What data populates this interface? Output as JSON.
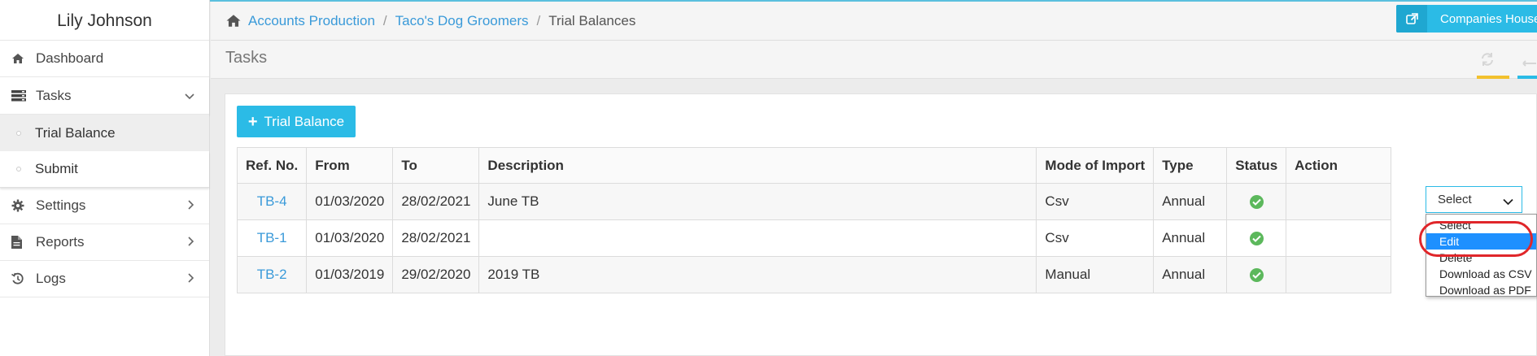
{
  "user": {
    "name": "Lily Johnson"
  },
  "nav": {
    "dashboard": "Dashboard",
    "tasks": "Tasks",
    "trial_balance": "Trial Balance",
    "submit": "Submit",
    "settings": "Settings",
    "reports": "Reports",
    "logs": "Logs"
  },
  "breadcrumb": {
    "items": [
      "Accounts Production",
      "Taco's Dog Groomers"
    ],
    "separator": "/",
    "current": "Trial Balances"
  },
  "header_button": {
    "label": "Companies House"
  },
  "page": {
    "title": "Tasks"
  },
  "toolbar": {
    "add_label": "Trial Balance",
    "add_symbol": "+"
  },
  "table": {
    "headers": [
      "Ref. No.",
      "From",
      "To",
      "Description",
      "Mode of Import",
      "Type",
      "Status",
      "Action"
    ],
    "rows": [
      {
        "ref": "TB-4",
        "from": "01/03/2020",
        "to": "28/02/2021",
        "description": "June TB",
        "mode": "Csv",
        "type": "Annual",
        "status": "complete"
      },
      {
        "ref": "TB-1",
        "from": "01/03/2020",
        "to": "28/02/2021",
        "description": "",
        "mode": "Csv",
        "type": "Annual",
        "status": "complete"
      },
      {
        "ref": "TB-2",
        "from": "01/03/2019",
        "to": "29/02/2020",
        "description": "2019 TB",
        "mode": "Manual",
        "type": "Annual",
        "status": "complete"
      }
    ]
  },
  "action_select": {
    "value": "Select",
    "options": [
      "Select",
      "Edit",
      "Delete",
      "Download as CSV",
      "Download as PDF"
    ],
    "highlighted": "Edit"
  },
  "colors": {
    "accent": "#2bbbe6",
    "link": "#3a9ad9",
    "status_ok": "#5cb85c",
    "highlight": "#1e90ff",
    "annotation": "#e0262a",
    "refresh_bar": "#f2c12e"
  },
  "icons": {
    "home": "home-icon",
    "dashboard": "home-icon",
    "tasks": "server-icon",
    "settings": "gear-icon",
    "reports": "document-icon",
    "logs": "history-icon",
    "external": "external-link-icon",
    "refresh": "refresh-icon",
    "status": "check-circle-icon"
  }
}
